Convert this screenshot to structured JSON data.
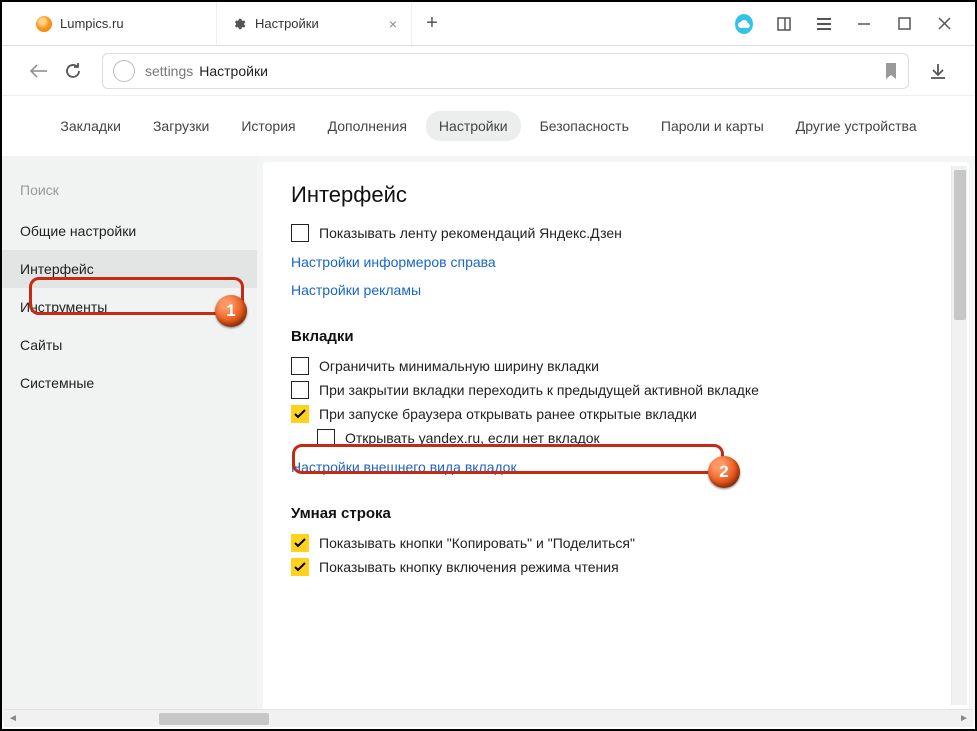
{
  "tabs": [
    {
      "label": "Lumpics.ru"
    },
    {
      "label": "Настройки"
    }
  ],
  "omnibox": {
    "prefix": "settings",
    "title": "Настройки"
  },
  "subnav": [
    "Закладки",
    "Загрузки",
    "История",
    "Дополнения",
    "Настройки",
    "Безопасность",
    "Пароли и карты",
    "Другие устройства"
  ],
  "subnav_selected": 4,
  "sidebar": {
    "search_placeholder": "Поиск",
    "items": [
      "Общие настройки",
      "Интерфейс",
      "Инструменты",
      "Сайты",
      "Системные"
    ],
    "selected": 1
  },
  "content": {
    "heading": "Интерфейс",
    "rec_zen": "Показывать ленту рекомендаций Яндекс.Дзен",
    "link_informers": "Настройки информеров справа",
    "link_ads": "Настройки рекламы",
    "tabs_heading": "Вкладки",
    "opt_limit_width": "Ограничить минимальную ширину вкладки",
    "opt_prev_active": "При закрытии вкладки переходить к предыдущей активной вкладке",
    "opt_restore": "При запуске браузера открывать ранее открытые вкладки",
    "opt_open_yandex": "Открывать yandex.ru, если нет вкладок",
    "link_tabs_appearance": "Настройки внешнего вида вкладок",
    "smart_heading": "Умная строка",
    "opt_copy_share": "Показывать кнопки \"Копировать\" и \"Поделиться\"",
    "opt_reader": "Показывать кнопку включения режима чтения"
  },
  "badges": {
    "one": "1",
    "two": "2"
  }
}
